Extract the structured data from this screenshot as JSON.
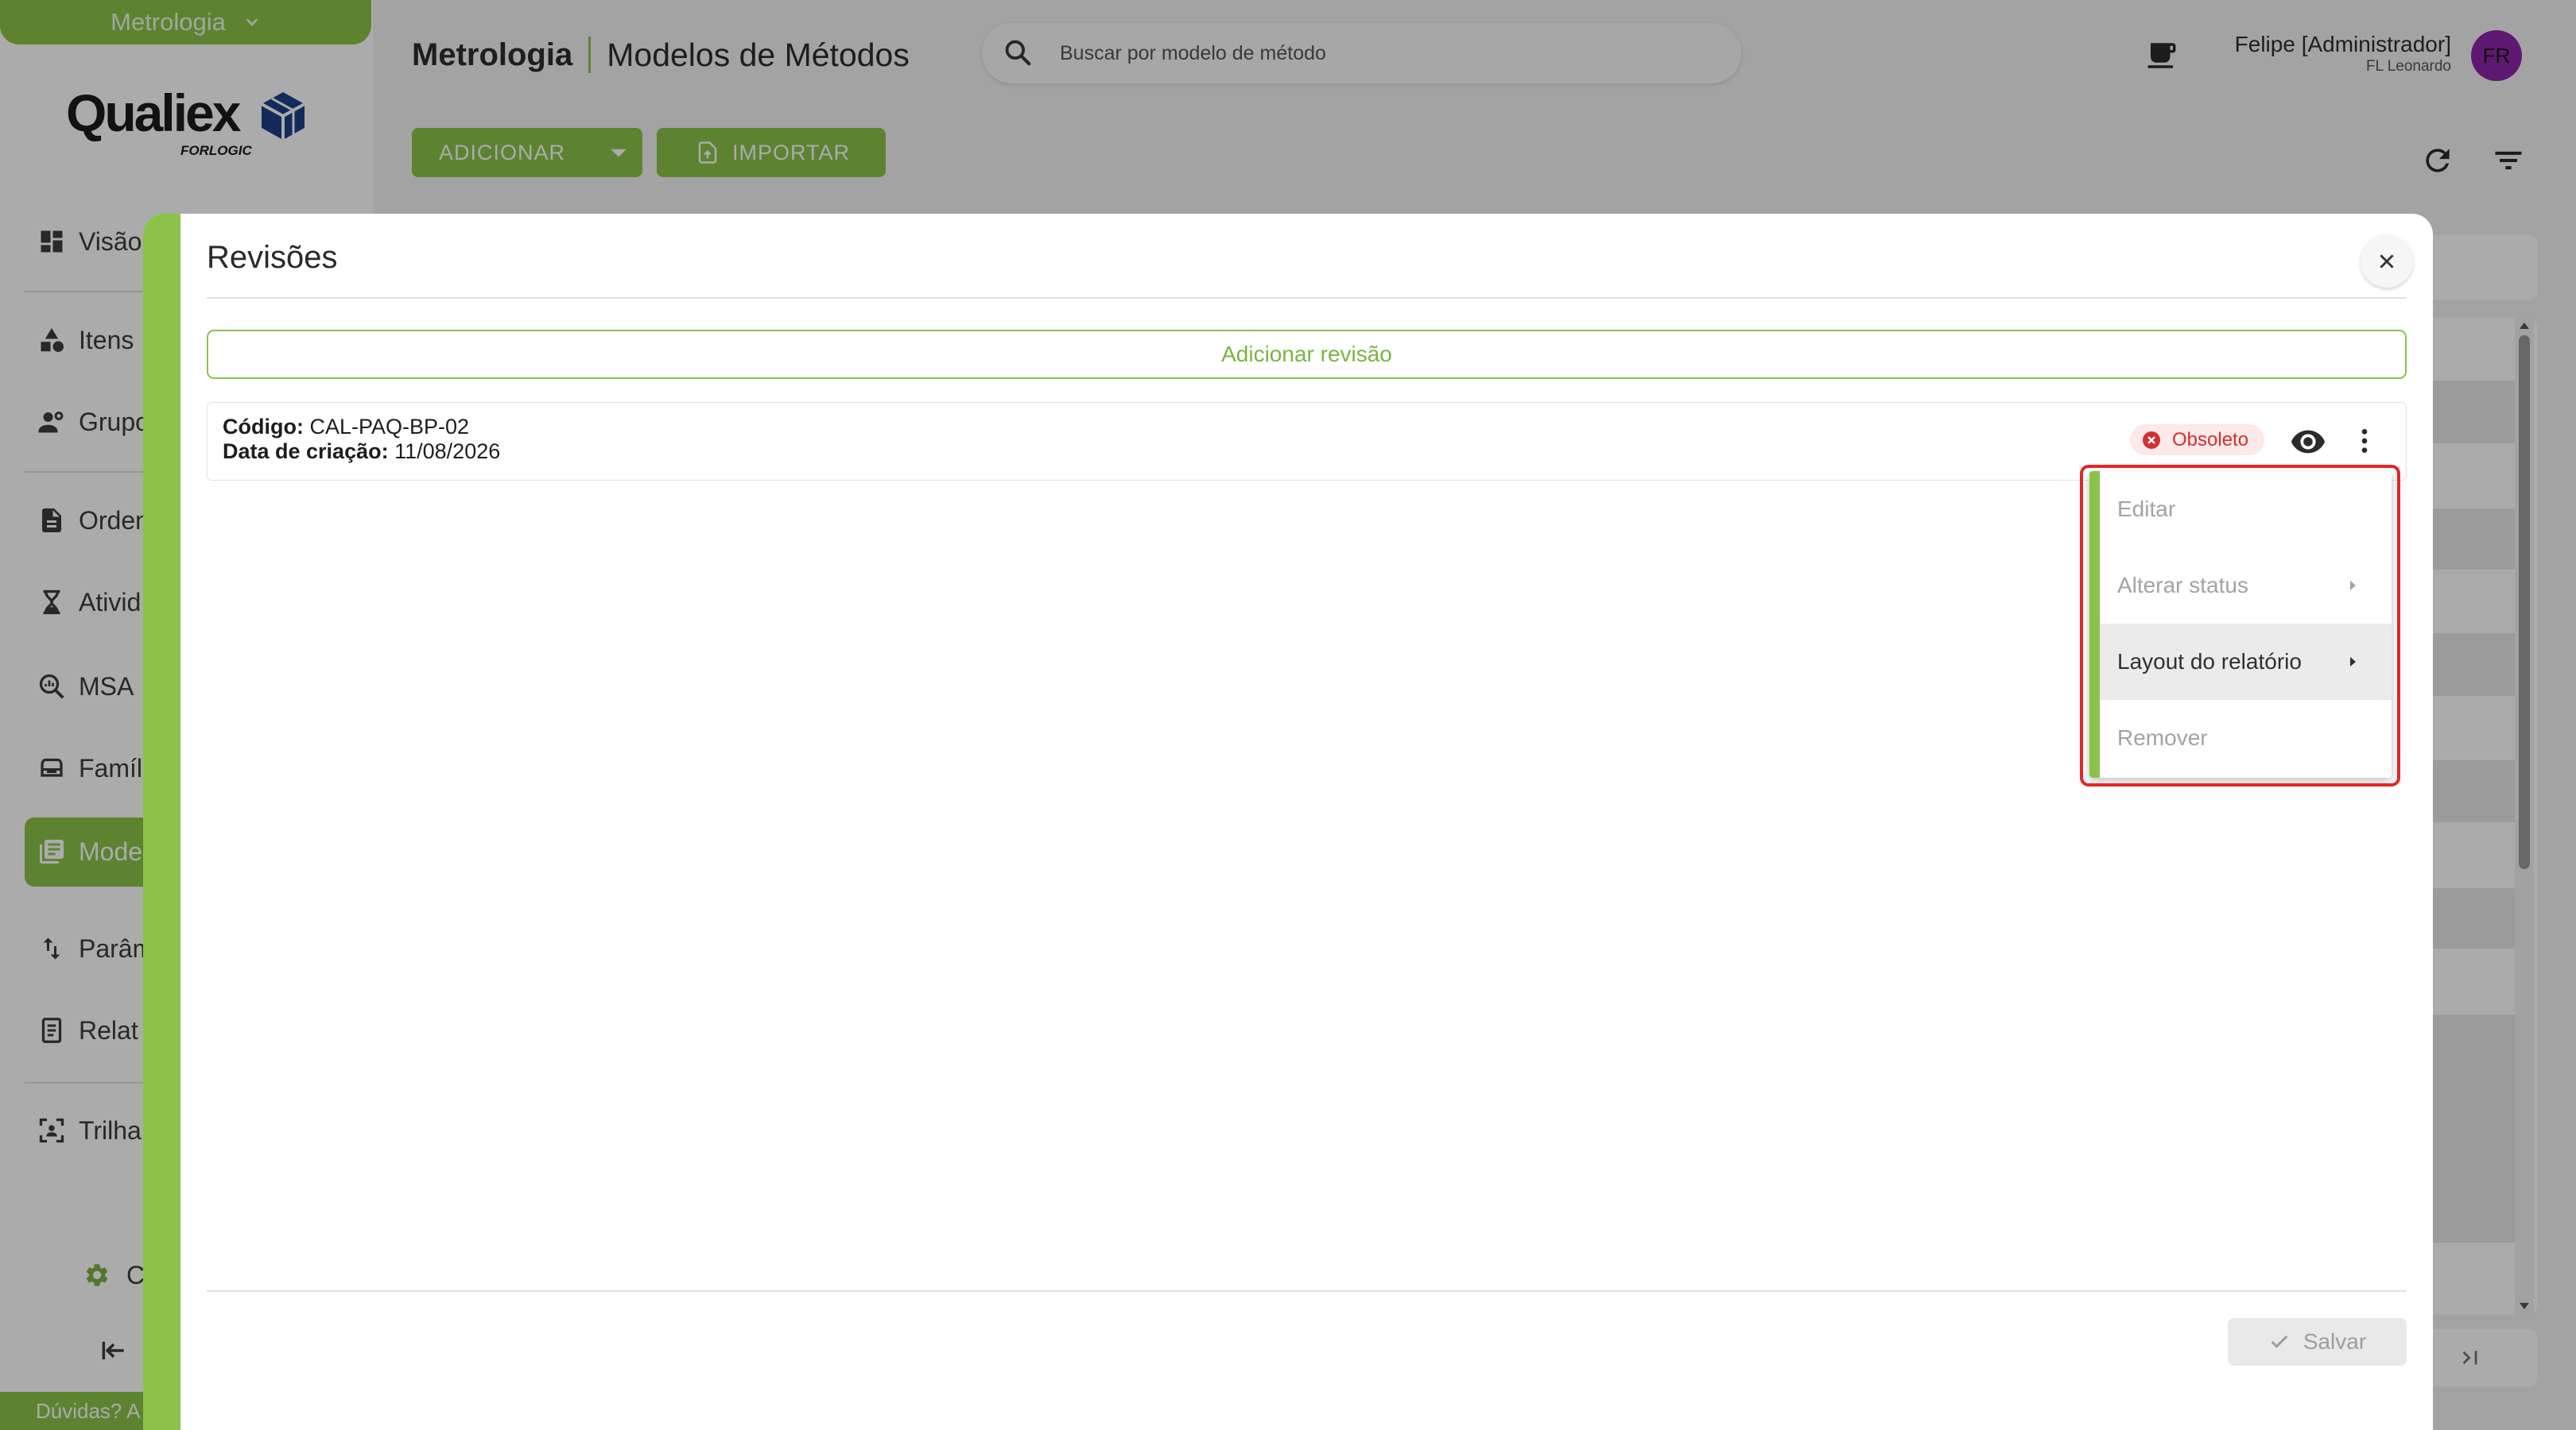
{
  "app_switcher": {
    "label": "Metrologia",
    "icon": "chevron-down-icon"
  },
  "logo": {
    "name": "Qualiex",
    "tagline": "FORLOGIC"
  },
  "sidebar": {
    "items": [
      {
        "label": "Visão",
        "icon": "dashboard-icon"
      },
      {
        "label": "Itens",
        "icon": "category-icon"
      },
      {
        "label": "Grupo",
        "icon": "group-icon"
      },
      {
        "label": "Orden",
        "icon": "document-icon"
      },
      {
        "label": "Ativid",
        "icon": "hourglass-icon"
      },
      {
        "label": "MSA",
        "icon": "analytics-search-icon"
      },
      {
        "label": "Famíl",
        "icon": "inbox-icon"
      },
      {
        "label": "Mode",
        "icon": "library-books-icon"
      },
      {
        "label": "Parâm",
        "icon": "swap-vert-icon"
      },
      {
        "label": "Relat",
        "icon": "report-icon"
      },
      {
        "label": "Trilha",
        "icon": "audit-trail-icon"
      }
    ],
    "active_index": 7,
    "settings_label": "C",
    "help_label": "Dúvidas? A"
  },
  "header": {
    "module": "Metrologia",
    "page_title": "Modelos de Métodos",
    "search_placeholder": "Buscar por modelo de método",
    "user_name": "Felipe [Administrador]",
    "user_org": "FL Leonardo",
    "avatar_initials": "FR"
  },
  "toolbar": {
    "add_label": "ADICIONAR",
    "import_label": "IMPORTAR"
  },
  "modal": {
    "title": "Revisões",
    "add_revision_label": "Adicionar revisão",
    "revisions": [
      {
        "code_label": "Código:",
        "code": "CAL-PAQ-BP-02",
        "created_label": "Data de criação:",
        "created": "11/08/2026",
        "status": "Obsoleto"
      }
    ],
    "context_menu": {
      "items": [
        {
          "label": "Editar",
          "enabled": false,
          "submenu": false
        },
        {
          "label": "Alterar status",
          "enabled": false,
          "submenu": true
        },
        {
          "label": "Layout do relatório",
          "enabled": true,
          "submenu": true,
          "hovered": true
        },
        {
          "label": "Remover",
          "enabled": false,
          "submenu": false
        }
      ]
    },
    "save_label": "Salvar"
  },
  "colors": {
    "accent": "#8bc34a",
    "accent_text": "#7cb342",
    "danger": "#d32f2f",
    "avatar": "#8e24aa",
    "highlight": "#e32626"
  }
}
